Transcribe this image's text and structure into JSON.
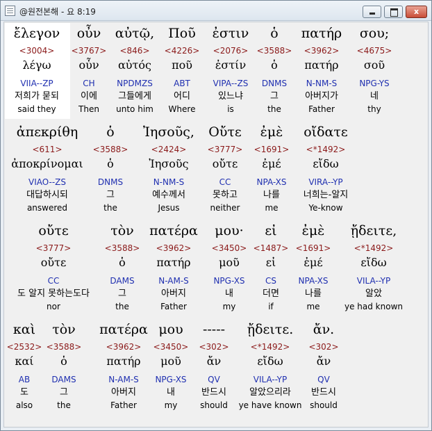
{
  "window": {
    "title": "@원전본해 - 요 8:19",
    "minimize_label": "",
    "maximize_label": "",
    "close_label": "x"
  },
  "lines": [
    {
      "words": [
        {
          "greek": "ἔλεγον",
          "strongs": "<3004>",
          "lemma": "λέγω",
          "morph": "VIIA--ZP",
          "korean": "저희가 묻되",
          "english": "said they"
        },
        {
          "greek": "οὖν",
          "strongs": "<3767>",
          "lemma": "οὖν",
          "morph": "CH",
          "korean": "이에",
          "english": "Then"
        },
        {
          "greek": "αὐτῷ,",
          "strongs": "<846>",
          "lemma": "αὐτός",
          "morph": "NPDMZS",
          "korean": "그들에게",
          "english": "unto him"
        },
        {
          "greek": "Ποῦ",
          "strongs": "<4226>",
          "lemma": "ποῦ",
          "morph": "ABT",
          "korean": "어디",
          "english": "Where"
        },
        {
          "greek": "ἐστιν",
          "strongs": "<2076>",
          "lemma": "ἐστίν",
          "morph": "VIPA--ZS",
          "korean": "있느냐",
          "english": "is"
        },
        {
          "greek": "ὁ",
          "strongs": "<3588>",
          "lemma": "ὁ",
          "morph": "DNMS",
          "korean": "그",
          "english": "the"
        },
        {
          "greek": "πατήρ",
          "strongs": "<3962>",
          "lemma": "πατήρ",
          "morph": "N-NM-S",
          "korean": "아버지가",
          "english": "Father"
        },
        {
          "greek": "σου;",
          "strongs": "<4675>",
          "lemma": "σοῦ",
          "morph": "NPG-YS",
          "korean": "네",
          "english": "thy"
        }
      ]
    },
    {
      "words": [
        {
          "greek": "ἀπεκρίθη",
          "strongs": "<611>",
          "lemma": "ἀποκρίνομαι",
          "morph": "VIAO--ZS",
          "korean": "대답하시되",
          "english": "answered"
        },
        {
          "greek": "ὁ",
          "strongs": "<3588>",
          "lemma": "ὁ",
          "morph": "DNMS",
          "korean": "그",
          "english": "the"
        },
        {
          "greek": "Ἰησοῦς,",
          "strongs": "<2424>",
          "lemma": "Ἰησοῦς",
          "morph": "N-NM-S",
          "korean": "예수께서",
          "english": "Jesus"
        },
        {
          "greek": "Οὔτε",
          "strongs": "<3777>",
          "lemma": "οὔτε",
          "morph": "CC",
          "korean": "못하고",
          "english": "neither"
        },
        {
          "greek": "ἐμὲ",
          "strongs": "<1691>",
          "lemma": "ἐμέ",
          "morph": "NPA-XS",
          "korean": "나를",
          "english": "me"
        },
        {
          "greek": "οἴδατε",
          "strongs": "<*1492>",
          "lemma": "εἴδω",
          "morph": "VIRA--YP",
          "korean": "너희는-알지",
          "english": "Ye-know"
        }
      ]
    },
    {
      "words": [
        {
          "greek": "οὔτε",
          "strongs": "<3777>",
          "lemma": "οὔτε",
          "morph": "CC",
          "korean": "도 알지 못하는도다",
          "english": "nor"
        },
        {
          "greek": "τὸν",
          "strongs": "<3588>",
          "lemma": "ὁ",
          "morph": "DAMS",
          "korean": "그",
          "english": "the"
        },
        {
          "greek": "πατέρα",
          "strongs": "<3962>",
          "lemma": "πατήρ",
          "morph": "N-AM-S",
          "korean": "아버지",
          "english": "Father"
        },
        {
          "greek": "μου·",
          "strongs": "<3450>",
          "lemma": "μοῦ",
          "morph": "NPG-XS",
          "korean": "내",
          "english": "my"
        },
        {
          "greek": "εἰ",
          "strongs": "<1487>",
          "lemma": "εἰ",
          "morph": "CS",
          "korean": "더면",
          "english": "if"
        },
        {
          "greek": "ἐμὲ",
          "strongs": "<1691>",
          "lemma": "ἐμέ",
          "morph": "NPA-XS",
          "korean": "나를",
          "english": "me"
        },
        {
          "greek": "ᾔδειτε,",
          "strongs": "<*1492>",
          "lemma": "εἴδω",
          "morph": "VILA--YP",
          "korean": "알았",
          "english": "ye had known"
        }
      ]
    },
    {
      "words": [
        {
          "greek": "καὶ",
          "strongs": "<2532>",
          "lemma": "καί",
          "morph": "AB",
          "korean": "도",
          "english": "also"
        },
        {
          "greek": "τὸν",
          "strongs": "<3588>",
          "lemma": "ὁ",
          "morph": "DAMS",
          "korean": "그",
          "english": "the"
        },
        {
          "greek": "πατέρα",
          "strongs": "<3962>",
          "lemma": "πατήρ",
          "morph": "N-AM-S",
          "korean": "아버지",
          "english": "Father"
        },
        {
          "greek": "μου",
          "strongs": "<3450>",
          "lemma": "μοῦ",
          "morph": "NPG-XS",
          "korean": "내",
          "english": "my"
        },
        {
          "greek": "-----",
          "strongs": "<302>",
          "lemma": "ἄν",
          "morph": "QV",
          "korean": "반드시",
          "english": "should"
        },
        {
          "greek": "ᾔδειτε.",
          "strongs": "<*1492>",
          "lemma": "εἴδω",
          "morph": "VILA--YP",
          "korean": "알았으리라",
          "english": "ye have known"
        },
        {
          "greek": "ἄν.",
          "strongs": "<302>",
          "lemma": "ἄν",
          "morph": "QV",
          "korean": "반드시",
          "english": "should"
        }
      ]
    }
  ]
}
